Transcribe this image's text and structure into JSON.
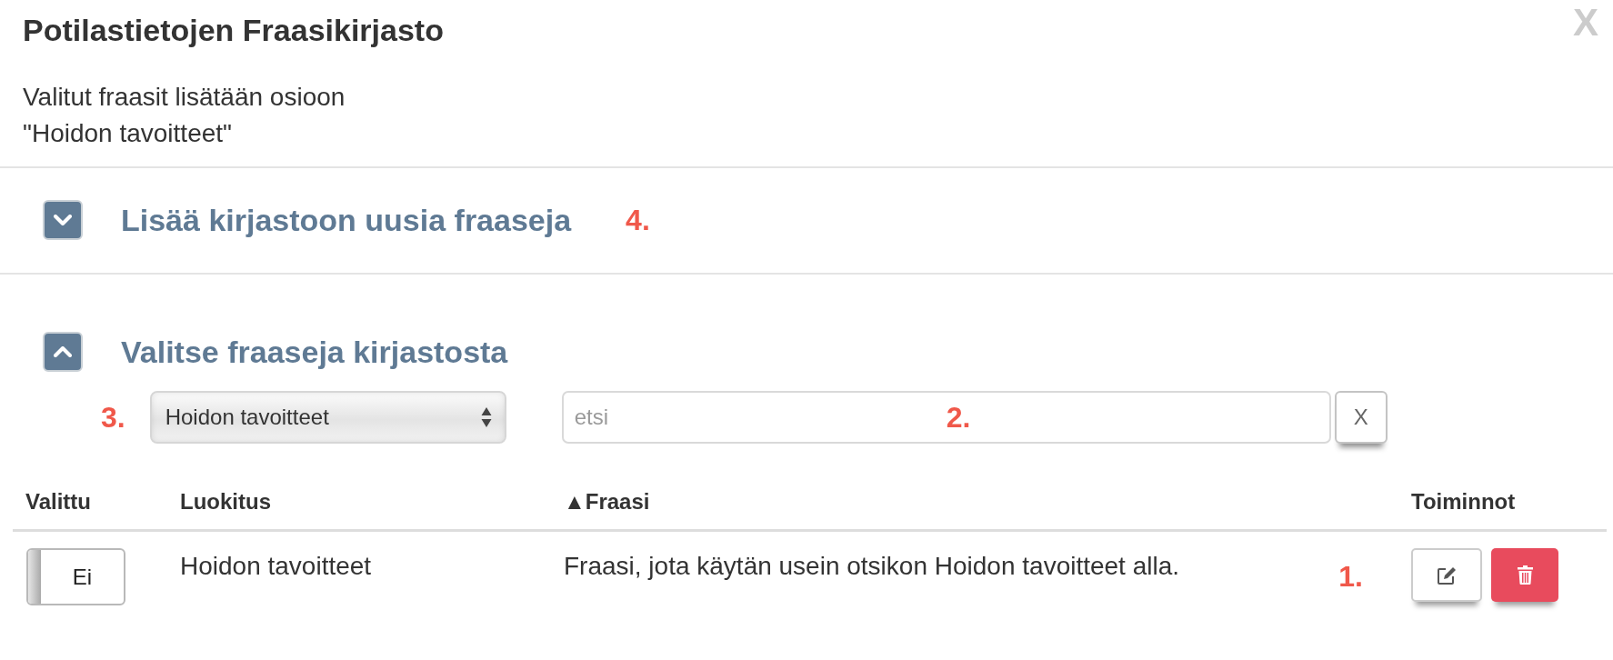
{
  "dialog": {
    "title": "Potilastietojen Fraasikirjasto",
    "close": "X",
    "description": "Valitut fraasit lisätään osioon \"Hoidon tavoitteet\""
  },
  "sections": [
    {
      "title": "Lisää kirjastoon uusia fraaseja",
      "expanded": false,
      "annotation": "4."
    },
    {
      "title": "Valitse fraaseja kirjastosta",
      "expanded": true,
      "filters": {
        "category": {
          "value": "Hoidon tavoitteet",
          "annotation": "3."
        },
        "search": {
          "placeholder": "etsi",
          "annotation": "2."
        },
        "clear_button": "X"
      },
      "table": {
        "columns": [
          "Valittu",
          "Luokitus",
          "▲Fraasi",
          "Toiminnot"
        ],
        "rows": [
          {
            "selected": false,
            "toggle_label": "Ei",
            "category": "Hoidon tavoitteet",
            "phrase": "Fraasi, jota käytän usein otsikon Hoidon tavoitteet alla.",
            "annotation": "1."
          }
        ]
      }
    }
  ]
}
